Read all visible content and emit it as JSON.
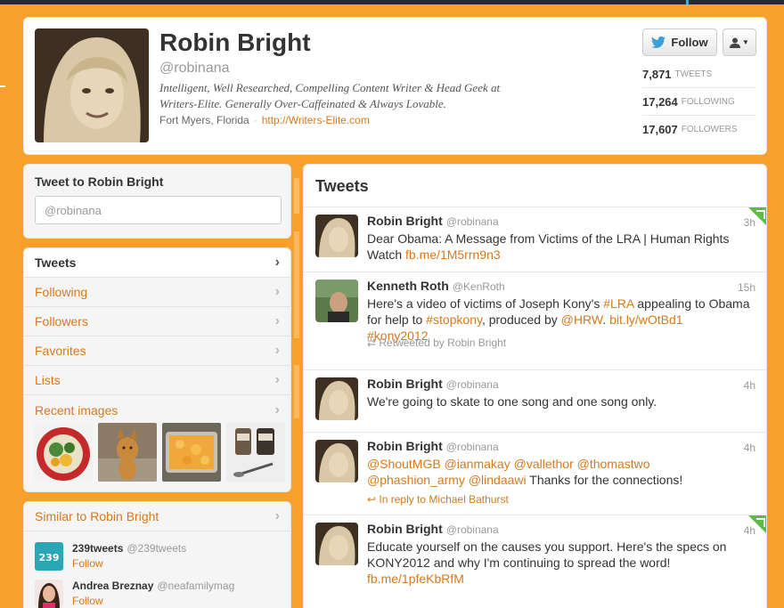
{
  "profile": {
    "name": "Robin Bright",
    "handle": "@robinana",
    "bio": "Intelligent, Well Researched, Compelling Content Writer & Head Geek at Writers-Elite. Generally Over-Caffeinated & Always Lovable.",
    "location": "Fort Myers, Florida",
    "separator": "·",
    "website": "http://Writers-Elite.com",
    "follow_label": "Follow",
    "stats": [
      {
        "count": "7,871",
        "label": "TWEETS"
      },
      {
        "count": "17,264",
        "label": "FOLLOWING"
      },
      {
        "count": "17,607",
        "label": "FOLLOWERS"
      }
    ]
  },
  "tweetbox": {
    "title": "Tweet to Robin Bright",
    "placeholder": "@robinana"
  },
  "nav": {
    "items": [
      {
        "label": "Tweets"
      },
      {
        "label": "Following"
      },
      {
        "label": "Followers"
      },
      {
        "label": "Favorites"
      },
      {
        "label": "Lists"
      },
      {
        "label": "Recent images"
      }
    ],
    "chevron": "›"
  },
  "similar": {
    "title": "Similar to Robin Bright",
    "users": [
      {
        "name": "239tweets",
        "handle": "@239tweets",
        "action": "Follow",
        "avatar_text": "239"
      },
      {
        "name": "Andrea Breznay",
        "handle": "@neafamilymag",
        "action": "Follow"
      }
    ]
  },
  "timeline": {
    "title": "Tweets",
    "tweets": [
      {
        "name": "Robin Bright",
        "handle": "@robinana",
        "time": "3h",
        "text": "Dear Obama: A Message from Victims of the LRA | Human Rights Watch ",
        "link": "fb.me/1M5rrn9n3"
      },
      {
        "name": "Kenneth Roth",
        "handle": "@KenRoth",
        "time": "15h",
        "t1": "Here's a video of victims of Joseph Kony's ",
        "h1": "#LRA",
        "t2": " appealing to Obama for help to ",
        "h2": "#stopkony",
        "t3": ", produced by ",
        "h3": "@HRW",
        "t4": ". ",
        "h4": "bit.ly/wOtBd1",
        "h5": "#kony2012",
        "meta": "Retweeted by Robin Bright"
      },
      {
        "name": "Robin Bright",
        "handle": "@robinana",
        "time": "4h",
        "text": "We're going to skate to one song and one song only."
      },
      {
        "name": "Robin Bright",
        "handle": "@robinana",
        "time": "4h",
        "m1": "@ShoutMGB",
        "m2": "@ianmakay",
        "m3": "@vallethor",
        "m4": "@thomastwo",
        "m5": "@phashion_army",
        "m6": "@lindaawi",
        "text": " Thanks for the connections!",
        "meta": "In reply to Michael Bathurst"
      },
      {
        "name": "Robin Bright",
        "handle": "@robinana",
        "time": "4h",
        "text": "Educate yourself on the causes you support. Here's the specs on KONY2012 and why I'm continuing to spread the word! ",
        "link": "fb.me/1pfeKbRfM"
      }
    ]
  },
  "colors": {
    "background": "#f7a02c",
    "link": "#d6791b",
    "flag": "#5dbb46"
  }
}
